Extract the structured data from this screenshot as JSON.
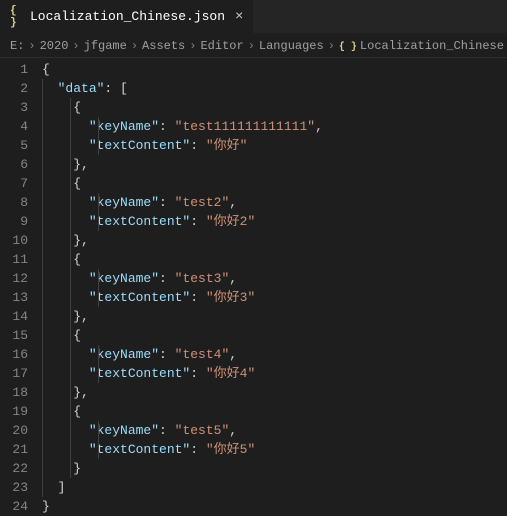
{
  "tab": {
    "icon_label": "{ }",
    "title": "Localization_Chinese.json",
    "close": "×"
  },
  "breadcrumbs": {
    "items": [
      "E:",
      "2020",
      "jfgame",
      "Assets",
      "Editor",
      "Languages"
    ],
    "file": "Localization_Chinese.json",
    "file_icon": "{ }",
    "trailing": "..."
  },
  "code": {
    "root_key": "data",
    "key_name_label": "keyName",
    "text_content_label": "textContent",
    "entries": [
      {
        "keyName": "test111111111111",
        "textContent": "你好"
      },
      {
        "keyName": "test2",
        "textContent": "你好2"
      },
      {
        "keyName": "test3",
        "textContent": "你好3"
      },
      {
        "keyName": "test4",
        "textContent": "你好4"
      },
      {
        "keyName": "test5",
        "textContent": "你好5"
      }
    ]
  },
  "line_numbers": [
    "1",
    "2",
    "3",
    "4",
    "5",
    "6",
    "7",
    "8",
    "9",
    "10",
    "11",
    "12",
    "13",
    "14",
    "15",
    "16",
    "17",
    "18",
    "19",
    "20",
    "21",
    "22",
    "23",
    "24"
  ]
}
